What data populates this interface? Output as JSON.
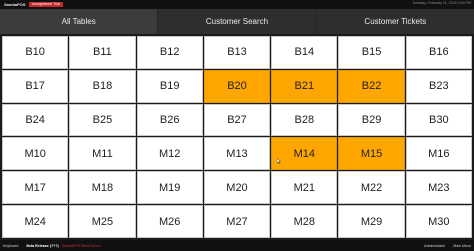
{
  "app": {
    "title": "SambaPOS",
    "badge": "Unregistered Trial",
    "datetime": "Tuesday, February 11, 2025 9:49 PM"
  },
  "tabs": [
    {
      "label": "All Tables"
    },
    {
      "label": "Customer Search"
    },
    {
      "label": "Customer Tickets"
    }
  ],
  "tables": [
    {
      "label": "B10",
      "busy": false
    },
    {
      "label": "B11",
      "busy": false
    },
    {
      "label": "B12",
      "busy": false
    },
    {
      "label": "B13",
      "busy": false
    },
    {
      "label": "B14",
      "busy": false
    },
    {
      "label": "B15",
      "busy": false
    },
    {
      "label": "B16",
      "busy": false
    },
    {
      "label": "B17",
      "busy": false
    },
    {
      "label": "B18",
      "busy": false
    },
    {
      "label": "B19",
      "busy": false
    },
    {
      "label": "B20",
      "busy": true
    },
    {
      "label": "B21",
      "busy": true
    },
    {
      "label": "B22",
      "busy": true
    },
    {
      "label": "B23",
      "busy": false
    },
    {
      "label": "B24",
      "busy": false
    },
    {
      "label": "B25",
      "busy": false
    },
    {
      "label": "B26",
      "busy": false
    },
    {
      "label": "B27",
      "busy": false
    },
    {
      "label": "B28",
      "busy": false
    },
    {
      "label": "B29",
      "busy": false
    },
    {
      "label": "B30",
      "busy": false
    },
    {
      "label": "M10",
      "busy": false
    },
    {
      "label": "M11",
      "busy": false
    },
    {
      "label": "M12",
      "busy": false
    },
    {
      "label": "M13",
      "busy": false
    },
    {
      "label": "M14",
      "busy": true
    },
    {
      "label": "M15",
      "busy": true
    },
    {
      "label": "M16",
      "busy": false
    },
    {
      "label": "M17",
      "busy": false
    },
    {
      "label": "M18",
      "busy": false
    },
    {
      "label": "M19",
      "busy": false
    },
    {
      "label": "M20",
      "busy": false
    },
    {
      "label": "M21",
      "busy": false
    },
    {
      "label": "M22",
      "busy": false
    },
    {
      "label": "M23",
      "busy": false
    },
    {
      "label": "M24",
      "busy": false
    },
    {
      "label": "M25",
      "busy": false
    },
    {
      "label": "M26",
      "busy": false
    },
    {
      "label": "M27",
      "busy": false
    },
    {
      "label": "M28",
      "busy": false
    },
    {
      "label": "M29",
      "busy": false
    },
    {
      "label": "M30",
      "busy": false
    }
  ],
  "status": {
    "left": "Keyboard",
    "release": "Beta Release (???)",
    "link": "SambaPOS Beta Forum",
    "user": "Administrator",
    "screen": "Main Menu"
  },
  "colors": {
    "busy": "#ffa600",
    "free": "#ffffff",
    "background": "#1b1b1b"
  }
}
